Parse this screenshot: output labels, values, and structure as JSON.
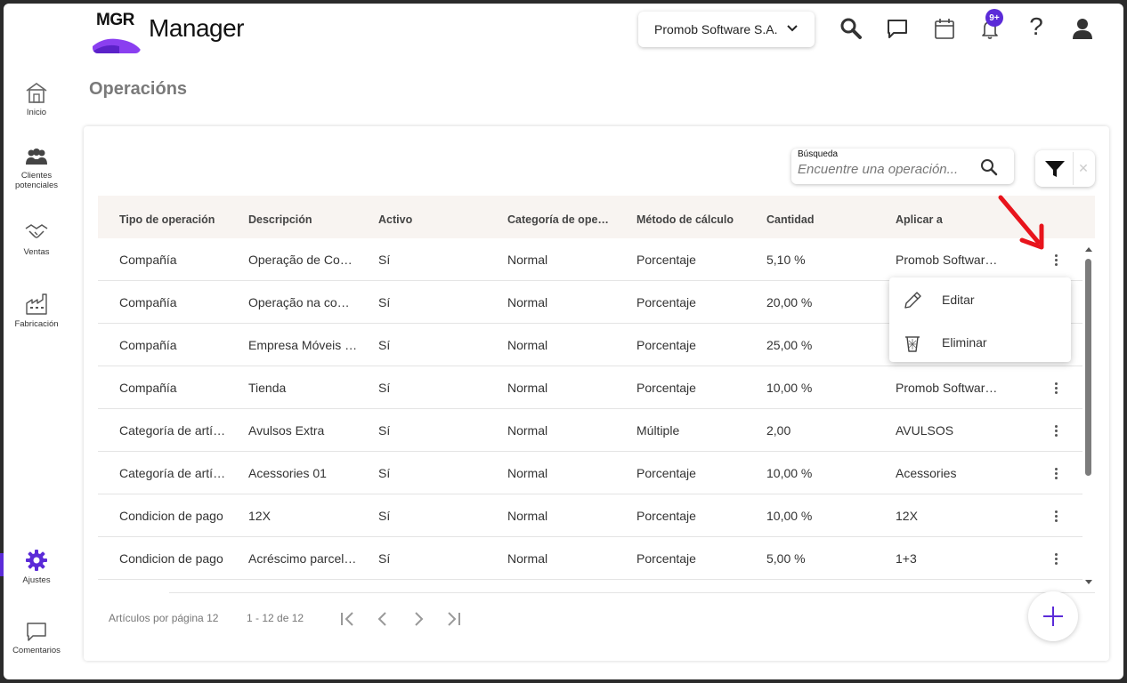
{
  "header": {
    "app_title": "Manager",
    "logo_text": "MGR",
    "company": "Promob Software S.A.",
    "notification_badge": "9+",
    "help_label": "?"
  },
  "sidebar": {
    "items": [
      {
        "label": "Inicio"
      },
      {
        "label": "Clientes potenciales"
      },
      {
        "label": "Ventas"
      },
      {
        "label": "Fabricación"
      },
      {
        "label": "Ajustes"
      },
      {
        "label": "Comentarios"
      }
    ]
  },
  "page": {
    "title": "Operacións"
  },
  "search": {
    "label": "Búsqueda",
    "placeholder": "Encuentre una operación...",
    "value": ""
  },
  "table": {
    "columns": [
      "Tipo de operación",
      "Descripción",
      "Activo",
      "Categoría de operación",
      "Método de cálculo",
      "Cantidad",
      "Aplicar a"
    ],
    "rows": [
      [
        "Compañía",
        "Operação de Compra",
        "Sí",
        "Normal",
        "Porcentaje",
        "5,10 %",
        "Promob Software S.A."
      ],
      [
        "Compañía",
        "Operação na compra",
        "Sí",
        "Normal",
        "Porcentaje",
        "20,00 %",
        ""
      ],
      [
        "Compañía",
        "Empresa Móveis e Cia",
        "Sí",
        "Normal",
        "Porcentaje",
        "25,00 %",
        ""
      ],
      [
        "Compañía",
        "Tienda",
        "Sí",
        "Normal",
        "Porcentaje",
        "10,00 %",
        "Promob Software S.A."
      ],
      [
        "Categoría de artículo",
        "Avulsos Extra",
        "Sí",
        "Normal",
        "Múltiple",
        "2,00",
        "AVULSOS"
      ],
      [
        "Categoría de artículo",
        "Acessories 01",
        "Sí",
        "Normal",
        "Porcentaje",
        "10,00 %",
        "Acessories"
      ],
      [
        "Condicion de pago",
        "12X",
        "Sí",
        "Normal",
        "Porcentaje",
        "10,00 %",
        "12X"
      ],
      [
        "Condicion de pago",
        "Acréscimo parcelado",
        "Sí",
        "Normal",
        "Porcentaje",
        "5,00 %",
        "1+3"
      ]
    ]
  },
  "context_menu": {
    "items": [
      {
        "label": "Editar",
        "icon": "pencil-icon"
      },
      {
        "label": "Eliminar",
        "icon": "trash-icon"
      }
    ]
  },
  "pagination": {
    "per_page_label": "Artículos por página 12",
    "range": "1 - 12 de 12"
  },
  "colors": {
    "accent": "#5b2bd8",
    "annotation_arrow": "#e8141c",
    "header_row_bg": "#f8f4f1"
  }
}
